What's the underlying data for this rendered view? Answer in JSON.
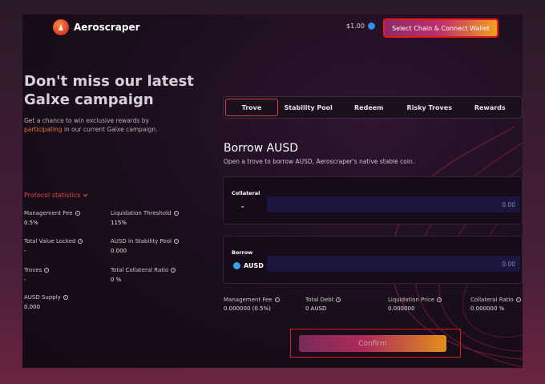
{
  "header": {
    "app_name": "Aeroscraper",
    "price": "$1.00",
    "connect_label": "Select Chain & Connect Wallet"
  },
  "hero": {
    "title": "Don't miss our latest Galxe campaign",
    "sub_before": "Get a chance to win exclusive rewards by",
    "sub_link": "participating",
    "sub_after": " in our current Galxe campaign."
  },
  "stats": {
    "toggle_label": "Protocol statistics",
    "items": [
      {
        "label": "Management Fee",
        "value": "0.5%"
      },
      {
        "label": "Liquidation Threshold",
        "value": "115%"
      },
      {
        "label": "Total Value Locked",
        "value": "-"
      },
      {
        "label": "AUSD in Stability Pool",
        "value": "0.000"
      },
      {
        "label": "Troves",
        "value": "-"
      },
      {
        "label": "Total Collateral Ratio",
        "value": "0 %"
      },
      {
        "label": "AUSD Supply",
        "value": "0.000"
      }
    ]
  },
  "tabs": [
    "Trove",
    "Stability Pool",
    "Redeem",
    "Risky Troves",
    "Rewards"
  ],
  "borrow": {
    "title": "Borrow AUSD",
    "subtitle": "Open a trove to borrow AUSD, Aeroscraper's native stable coin.",
    "collateral": {
      "label": "Collateral",
      "asset": "-",
      "value": "0.00"
    },
    "borrow": {
      "label": "Borrow",
      "asset": "AUSD",
      "value": "0.00"
    }
  },
  "metrics": [
    {
      "label": "Management Fee",
      "value": "0.000000 (0.5%)"
    },
    {
      "label": "Total Debt",
      "value": "0 AUSD"
    },
    {
      "label": "Liquidation Price",
      "value": "0.000000"
    },
    {
      "label": "Collateral Ratio",
      "value": "0.000000 %"
    }
  ],
  "confirm_label": "Confirm",
  "colors": {
    "accent": "#e04848",
    "link": "#e87a3a",
    "input_bg": "#1a1640"
  },
  "icons": [
    "aeroscraper-logo-icon",
    "chain-token-icon",
    "chevron-down-icon",
    "info-icon",
    "ausd-token-icon"
  ]
}
